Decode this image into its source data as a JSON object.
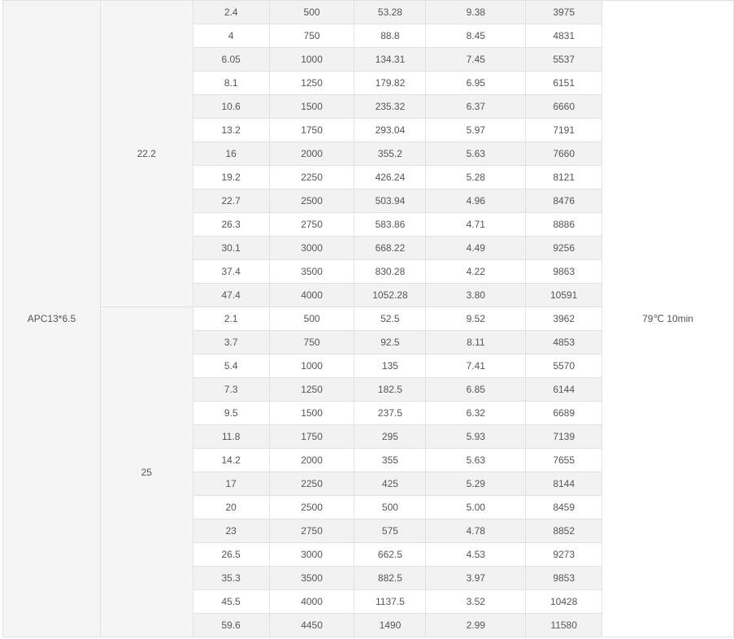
{
  "table": {
    "propeller": "APC13*6.5",
    "note": "79℃ 10min",
    "groups": [
      {
        "voltage": "22.2",
        "rows": [
          [
            "2.4",
            "500",
            "53.28",
            "9.38",
            "3975"
          ],
          [
            "4",
            "750",
            "88.8",
            "8.45",
            "4831"
          ],
          [
            "6.05",
            "1000",
            "134.31",
            "7.45",
            "5537"
          ],
          [
            "8.1",
            "1250",
            "179.82",
            "6.95",
            "6151"
          ],
          [
            "10.6",
            "1500",
            "235.32",
            "6.37",
            "6660"
          ],
          [
            "13.2",
            "1750",
            "293.04",
            "5.97",
            "7191"
          ],
          [
            "16",
            "2000",
            "355.2",
            "5.63",
            "7660"
          ],
          [
            "19.2",
            "2250",
            "426.24",
            "5.28",
            "8121"
          ],
          [
            "22.7",
            "2500",
            "503.94",
            "4.96",
            "8476"
          ],
          [
            "26.3",
            "2750",
            "583.86",
            "4.71",
            "8886"
          ],
          [
            "30.1",
            "3000",
            "668.22",
            "4.49",
            "9256"
          ],
          [
            "37.4",
            "3500",
            "830.28",
            "4.22",
            "9863"
          ],
          [
            "47.4",
            "4000",
            "1052.28",
            "3.80",
            "10591"
          ]
        ]
      },
      {
        "voltage": "25",
        "rows": [
          [
            "2.1",
            "500",
            "52.5",
            "9.52",
            "3962"
          ],
          [
            "3.7",
            "750",
            "92.5",
            "8.11",
            "4853"
          ],
          [
            "5.4",
            "1000",
            "135",
            "7.41",
            "5570"
          ],
          [
            "7.3",
            "1250",
            "182.5",
            "6.85",
            "6144"
          ],
          [
            "9.5",
            "1500",
            "237.5",
            "6.32",
            "6689"
          ],
          [
            "11.8",
            "1750",
            "295",
            "5.93",
            "7139"
          ],
          [
            "14.2",
            "2000",
            "355",
            "5.63",
            "7655"
          ],
          [
            "17",
            "2250",
            "425",
            "5.29",
            "8144"
          ],
          [
            "20",
            "2500",
            "500",
            "5.00",
            "8459"
          ],
          [
            "23",
            "2750",
            "575",
            "4.78",
            "8852"
          ],
          [
            "26.5",
            "3000",
            "662.5",
            "4.53",
            "9273"
          ],
          [
            "35.3",
            "3500",
            "882.5",
            "3.97",
            "9853"
          ],
          [
            "45.5",
            "4000",
            "1137.5",
            "3.52",
            "10428"
          ],
          [
            "59.6",
            "4450",
            "1490",
            "2.99",
            "11580"
          ]
        ]
      }
    ]
  }
}
